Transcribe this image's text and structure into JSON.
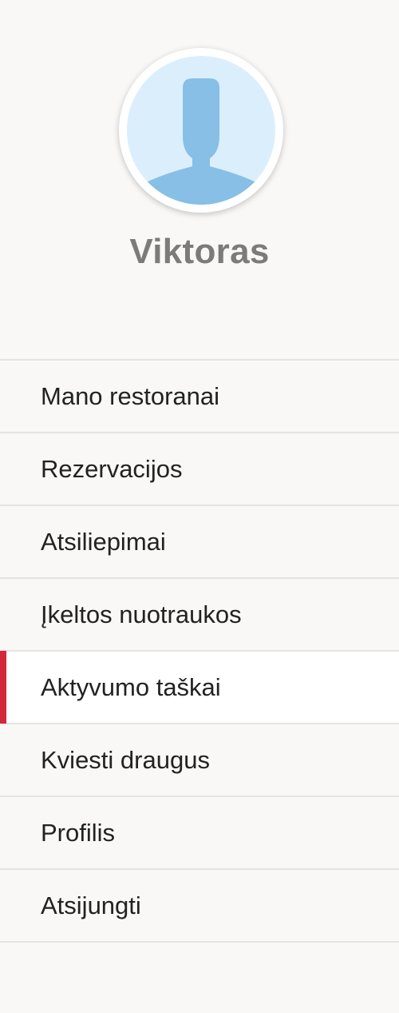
{
  "profile": {
    "avatar_icon": "default-user-silhouette-icon",
    "name": "Viktoras"
  },
  "menu": {
    "active_index": 4,
    "accent_color": "#d3283a",
    "items": [
      {
        "label": "Mano restoranai"
      },
      {
        "label": "Rezervacijos"
      },
      {
        "label": "Atsiliepimai"
      },
      {
        "label": "Įkeltos nuotraukos"
      },
      {
        "label": "Aktyvumo taškai"
      },
      {
        "label": "Kviesti draugus"
      },
      {
        "label": "Profilis"
      },
      {
        "label": "Atsijungti"
      }
    ]
  }
}
